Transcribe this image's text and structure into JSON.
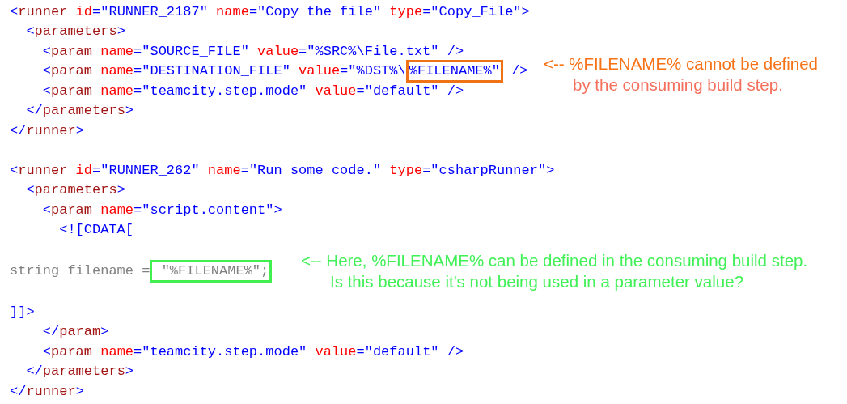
{
  "code_blocks": [
    {
      "lines": [
        {
          "tokens": [
            {
              "kind": "punct",
              "text": "<"
            },
            {
              "kind": "tag",
              "text": "runner"
            },
            {
              "kind": "attr",
              "text": " id"
            },
            {
              "kind": "punct",
              "text": "="
            },
            {
              "kind": "value",
              "text": "\"RUNNER_2187\""
            },
            {
              "kind": "attr",
              "text": " name"
            },
            {
              "kind": "punct",
              "text": "="
            },
            {
              "kind": "value",
              "text": "\"Copy the file\""
            },
            {
              "kind": "attr",
              "text": " type"
            },
            {
              "kind": "punct",
              "text": "="
            },
            {
              "kind": "value",
              "text": "\"Copy_File\""
            },
            {
              "kind": "punct",
              "text": ">"
            }
          ]
        },
        {
          "tokens": [
            {
              "kind": "punct",
              "text": "  <"
            },
            {
              "kind": "tag",
              "text": "parameters"
            },
            {
              "kind": "punct",
              "text": ">"
            }
          ]
        },
        {
          "tokens": [
            {
              "kind": "punct",
              "text": "    <"
            },
            {
              "kind": "tag",
              "text": "param"
            },
            {
              "kind": "attr",
              "text": " name"
            },
            {
              "kind": "punct",
              "text": "="
            },
            {
              "kind": "value",
              "text": "\"SOURCE_FILE\""
            },
            {
              "kind": "attr",
              "text": " value"
            },
            {
              "kind": "punct",
              "text": "="
            },
            {
              "kind": "value",
              "text": "\"%SRC%\\File.txt\""
            },
            {
              "kind": "punct",
              "text": " />"
            }
          ]
        },
        {
          "tokens": [
            {
              "kind": "punct",
              "text": "    <"
            },
            {
              "kind": "tag",
              "text": "param"
            },
            {
              "kind": "attr",
              "text": " name"
            },
            {
              "kind": "punct",
              "text": "="
            },
            {
              "kind": "value",
              "text": "\"DESTINATION_FILE\""
            },
            {
              "kind": "attr",
              "text": " value"
            },
            {
              "kind": "punct",
              "text": "="
            },
            {
              "kind": "value",
              "text": "\"%DST%\\"
            },
            {
              "kind": "value",
              "text": "%FILENAME%\"",
              "color": "#f07216"
            },
            {
              "kind": "punct",
              "text": " />"
            }
          ],
          "annotation": [
            {
              "text": "<-- %FILENAME% cannot be defined",
              "color": "#f77216"
            },
            {
              "text": "by the consuming build step.",
              "color": "#f46f5c"
            }
          ]
        },
        {
          "tokens": [
            {
              "kind": "punct",
              "text": "    <"
            },
            {
              "kind": "tag",
              "text": "param"
            },
            {
              "kind": "attr",
              "text": " name"
            },
            {
              "kind": "punct",
              "text": "="
            },
            {
              "kind": "value",
              "text": "\"teamcity.step.mode\""
            },
            {
              "kind": "attr",
              "text": " value"
            },
            {
              "kind": "punct",
              "text": "="
            },
            {
              "kind": "value",
              "text": "\"default\""
            },
            {
              "kind": "punct",
              "text": " />"
            }
          ]
        },
        {
          "tokens": [
            {
              "kind": "punct",
              "text": "  </"
            },
            {
              "kind": "tag",
              "text": "parameters"
            },
            {
              "kind": "punct",
              "text": ">"
            }
          ]
        },
        {
          "tokens": [
            {
              "kind": "punct",
              "text": "</"
            },
            {
              "kind": "tag",
              "text": "runner"
            },
            {
              "kind": "punct",
              "text": ">"
            }
          ]
        }
      ]
    },
    {
      "lines": [
        {
          "tokens": [
            {
              "kind": "punct",
              "text": "<"
            },
            {
              "kind": "tag",
              "text": "runner"
            },
            {
              "kind": "attr",
              "text": " id"
            },
            {
              "kind": "punct",
              "text": "="
            },
            {
              "kind": "value",
              "text": "\"RUNNER_262\""
            },
            {
              "kind": "attr",
              "text": " name"
            },
            {
              "kind": "punct",
              "text": "="
            },
            {
              "kind": "value",
              "text": "\"Run some code.\""
            },
            {
              "kind": "attr",
              "text": " type"
            },
            {
              "kind": "punct",
              "text": "="
            },
            {
              "kind": "value",
              "text": "\"csharpRunner\""
            },
            {
              "kind": "punct",
              "text": ">"
            }
          ]
        },
        {
          "tokens": [
            {
              "kind": "punct",
              "text": "  <"
            },
            {
              "kind": "tag",
              "text": "parameters"
            },
            {
              "kind": "punct",
              "text": ">"
            }
          ]
        },
        {
          "tokens": [
            {
              "kind": "punct",
              "text": "    <"
            },
            {
              "kind": "tag",
              "text": "param"
            },
            {
              "kind": "attr",
              "text": " name"
            },
            {
              "kind": "punct",
              "text": "="
            },
            {
              "kind": "value",
              "text": "\"script.content\""
            },
            {
              "kind": "punct",
              "text": ">"
            }
          ]
        },
        {
          "tokens": [
            {
              "kind": "punct",
              "text": "      <![CDATA["
            }
          ]
        }
      ]
    },
    {
      "lines": [
        {
          "tokens": [
            {
              "kind": "plain",
              "text": "string filename ="
            },
            {
              "kind": "plain",
              "text": " \"%FILENAME%\";",
              "color": "#41ef4f"
            }
          ],
          "annotation": [
            {
              "text": "<-- Here, %FILENAME% can be defined in the consuming build step.",
              "color": "#41f057"
            },
            {
              "text": "Is this because it's not being used in a parameter value?",
              "color": "#41f057"
            }
          ]
        }
      ]
    },
    {
      "lines": [
        {
          "tokens": [
            {
              "kind": "punct",
              "text": "]]>"
            }
          ]
        },
        {
          "tokens": [
            {
              "kind": "punct",
              "text": "    </"
            },
            {
              "kind": "tag",
              "text": "param"
            },
            {
              "kind": "punct",
              "text": ">"
            }
          ]
        },
        {
          "tokens": [
            {
              "kind": "punct",
              "text": "    <"
            },
            {
              "kind": "tag",
              "text": "param"
            },
            {
              "kind": "attr",
              "text": " name"
            },
            {
              "kind": "punct",
              "text": "="
            },
            {
              "kind": "value",
              "text": "\"teamcity.step.mode\""
            },
            {
              "kind": "attr",
              "text": " value"
            },
            {
              "kind": "punct",
              "text": "="
            },
            {
              "kind": "value",
              "text": "\"default\""
            },
            {
              "kind": "punct",
              "text": " />"
            }
          ]
        },
        {
          "tokens": [
            {
              "kind": "punct",
              "text": "  </"
            },
            {
              "kind": "tag",
              "text": "parameters"
            },
            {
              "kind": "punct",
              "text": ">"
            }
          ]
        },
        {
          "tokens": [
            {
              "kind": "punct",
              "text": "</"
            },
            {
              "kind": "tag",
              "text": "runner"
            },
            {
              "kind": "punct",
              "text": ">"
            }
          ]
        }
      ]
    }
  ]
}
